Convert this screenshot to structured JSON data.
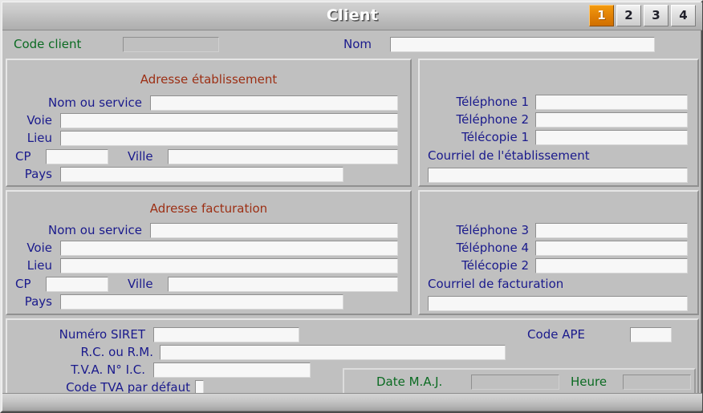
{
  "window": {
    "title": "Client"
  },
  "tabs": [
    {
      "label": "1",
      "active": true
    },
    {
      "label": "2",
      "active": false
    },
    {
      "label": "3",
      "active": false
    },
    {
      "label": "4",
      "active": false
    }
  ],
  "header": {
    "code_client_label": "Code client",
    "code_client_value": "",
    "nom_label": "Nom",
    "nom_value": ""
  },
  "adresse_etablissement": {
    "title": "Adresse établissement",
    "nom_service_label": "Nom ou service",
    "nom_service_value": "",
    "voie_label": "Voie",
    "voie_value": "",
    "lieu_label": "Lieu",
    "lieu_value": "",
    "cp_label": "CP",
    "cp_value": "",
    "ville_label": "Ville",
    "ville_value": "",
    "pays_label": "Pays",
    "pays_value": ""
  },
  "contact_etablissement": {
    "tel1_label": "Téléphone 1",
    "tel1_value": "",
    "tel2_label": "Téléphone 2",
    "tel2_value": "",
    "fax1_label": "Télécopie 1",
    "fax1_value": "",
    "courriel_label": "Courriel de l'établissement",
    "courriel_value": ""
  },
  "adresse_facturation": {
    "title": "Adresse facturation",
    "nom_service_label": "Nom ou service",
    "nom_service_value": "",
    "voie_label": "Voie",
    "voie_value": "",
    "lieu_label": "Lieu",
    "lieu_value": "",
    "cp_label": "CP",
    "cp_value": "",
    "ville_label": "Ville",
    "ville_value": "",
    "pays_label": "Pays",
    "pays_value": ""
  },
  "contact_facturation": {
    "tel3_label": "Téléphone 3",
    "tel3_value": "",
    "tel4_label": "Téléphone 4",
    "tel4_value": "",
    "fax2_label": "Télécopie 2",
    "fax2_value": "",
    "courriel_label": "Courriel de facturation",
    "courriel_value": ""
  },
  "legal": {
    "siret_label": "Numéro SIRET",
    "siret_value": "",
    "rc_label": "R.C. ou R.M.",
    "rc_value": "",
    "tva_label": "T.V.A. N° I.C.",
    "tva_value": "",
    "code_tva_label": "Code TVA par défaut",
    "code_tva_value": "",
    "code_ape_label": "Code APE",
    "code_ape_value": ""
  },
  "maj": {
    "date_label": "Date M.A.J.",
    "date_value": "",
    "heure_label": "Heure",
    "heure_value": ""
  },
  "colors": {
    "label": "#1a1a8c",
    "section_title": "#9c2f14",
    "readonly_label": "#0b6b22",
    "active_tab": "#e07f05",
    "window_bg": "#c0c0c0",
    "field_bg": "#f7f7f7"
  }
}
